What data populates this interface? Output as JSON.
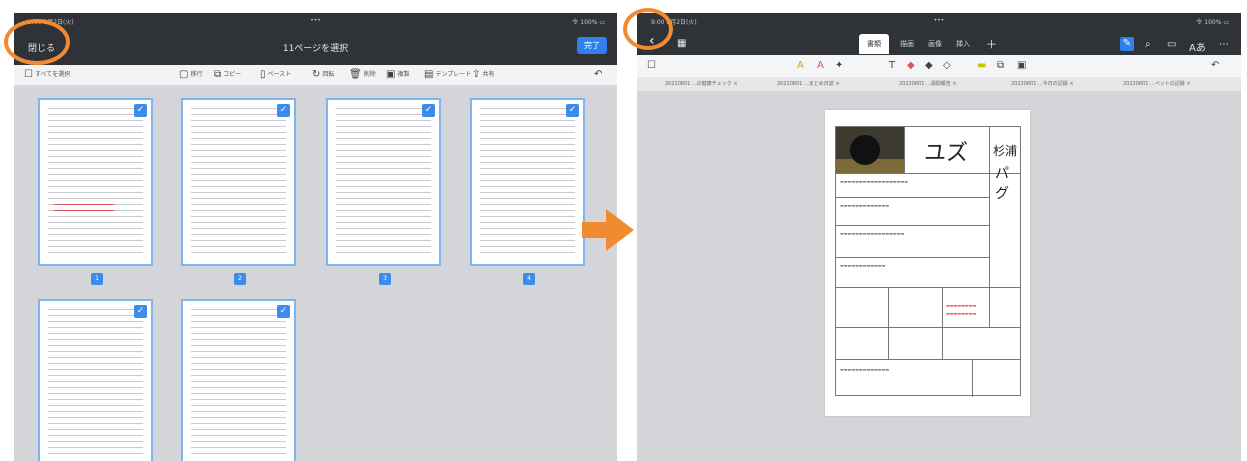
{
  "left": {
    "title": "11ページを選択",
    "close_label": "閉じる",
    "done_label": "完了",
    "status_time": "9:00 8月2日(火)",
    "status_center": "•••",
    "status_right": "令 100% ▭",
    "toolbar": {
      "select_all": "すべてを選択",
      "items": [
        "移行",
        "コピー",
        "ペースト",
        "回転",
        "削除",
        "複製",
        "テンプレート",
        "共有"
      ]
    },
    "page_numbers": [
      "1",
      "2",
      "3",
      "4"
    ]
  },
  "right": {
    "status_time": "9:00 8月2日(火)",
    "status_center": "•••",
    "status_right": "令 100% ▭",
    "tabs": [
      "書類",
      "描画",
      "画像",
      "挿入",
      "＋"
    ],
    "file_tabs": [
      "20220801 ...の健康チェック ×",
      "20220801 ...まとめ日誌 ×",
      "20220801 ...週間報告 ×",
      "20220801 ...今日の記録 ×",
      "20220801 ...ペットの記録 ×"
    ],
    "pet_name": "ユズ",
    "owner_name": "杉浦",
    "breed": "パグ"
  },
  "colors": {
    "accent": "#2f80ed",
    "highlight": "#f28a30",
    "dark_bar": "#2f3338"
  }
}
